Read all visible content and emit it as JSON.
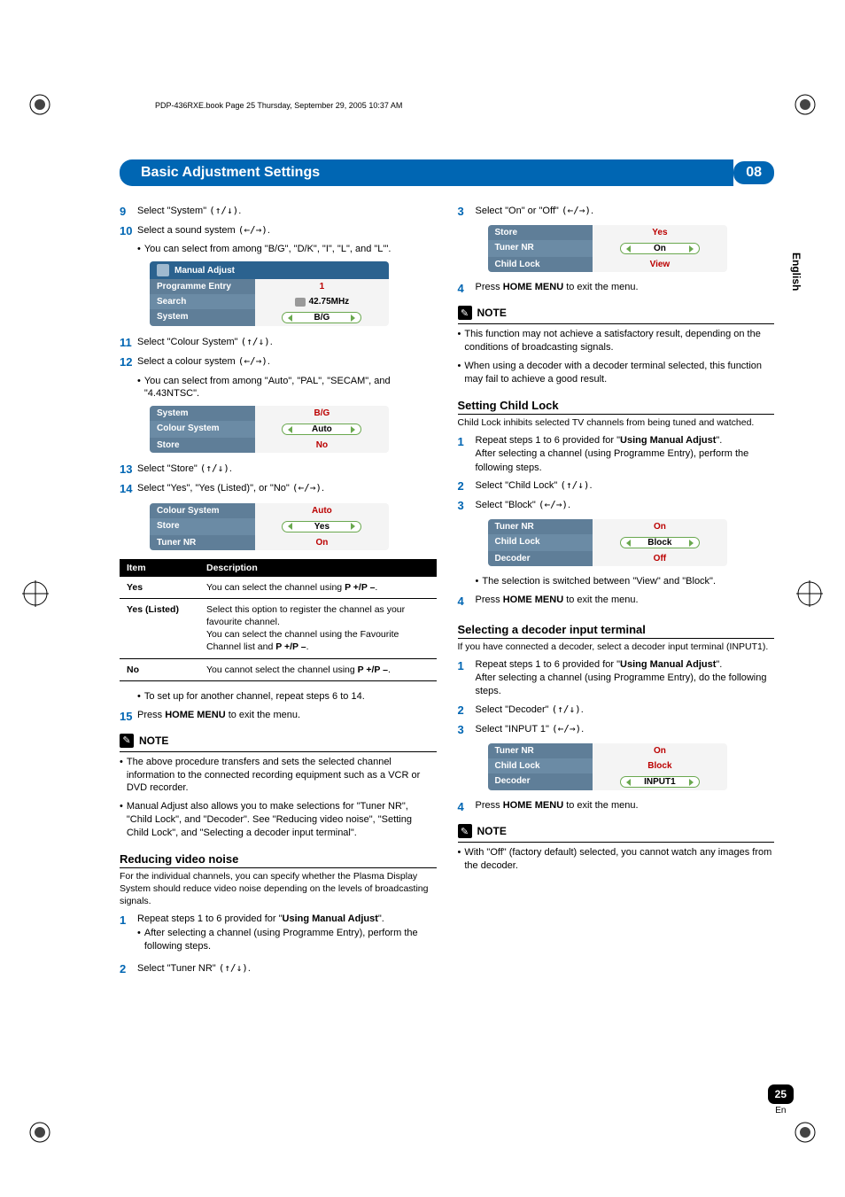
{
  "book_info": "PDP-436RXE.book  Page 25  Thursday, September 29, 2005  10:37 AM",
  "title": "Basic Adjustment Settings",
  "chapter": "08",
  "side_lang": "English",
  "page_lang_abbr": "En",
  "page_number": "25",
  "arrows_ud": "(↑/↓)",
  "arrows_lr": "(←/→)",
  "left": {
    "s9": "Select \"System\" ",
    "s10": "Select a sound system ",
    "s10b": "You can select from among \"B/G\", \"D/K\", \"I\", \"L\", and \"L'\".",
    "menu1": {
      "header": "Manual Adjust",
      "r1l": "Programme Entry",
      "r1v": "1",
      "r2l": "Search",
      "r2v": "42.75MHz",
      "r3l": "System",
      "r3v": "B/G"
    },
    "s11": "Select \"Colour System\" ",
    "s12": "Select a colour system ",
    "s12b": "You can select from among \"Auto\", \"PAL\", \"SECAM\", and \"4.43NTSC\".",
    "menu2": {
      "r1l": "System",
      "r1v": "B/G",
      "r2l": "Colour System",
      "r2v": "Auto",
      "r3l": "Store",
      "r3v": "No"
    },
    "s13": "Select \"Store\" ",
    "s14": "Select \"Yes\", \"Yes (Listed)\", or \"No\" ",
    "menu3": {
      "r1l": "Colour System",
      "r1v": "Auto",
      "r2l": "Store",
      "r2v": "Yes",
      "r3l": "Tuner NR",
      "r3v": "On"
    },
    "table_h1": "Item",
    "table_h2": "Description",
    "r1c1": "Yes",
    "r1c2a": "You can select the channel using ",
    "r1c2b": "P +/P –",
    "r2c1": "Yes (Listed)",
    "r2c2a": "Select this option to register the channel as your favourite channel.",
    "r2c2b": "You can select the channel using the Favourite Channel list and ",
    "r2c2c": "P +/P –",
    "r3c1": "No",
    "r3c2a": "You cannot select the channel using ",
    "r3c2b": "P +/P –",
    "tableb": "To set up for another channel, repeat steps 6 to 14.",
    "s15a": "Press ",
    "s15b": "HOME MENU",
    "s15c": " to exit the menu.",
    "note_label": "NOTE",
    "note1": "The above procedure transfers and sets the selected channel information to the connected recording equipment such as a VCR or DVD recorder.",
    "note2": "Manual Adjust also allows you to make selections for \"Tuner NR\", \"Child Lock\", and \"Decoder\". See \"Reducing video noise\", \"Setting Child Lock\", and \"Selecting a decoder input terminal\".",
    "sec_noise": "Reducing video noise",
    "sec_noise_sub": "For the individual channels, you can specify whether the Plasma Display System should reduce video noise depending on the levels of broadcasting signals.",
    "n1a": "Repeat steps 1 to 6 provided for \"",
    "n1b": "Using Manual Adjust",
    "n1c": "\".",
    "n1d": "After selecting a channel (using Programme Entry), perform the following steps.",
    "n2": "Select \"Tuner NR\" "
  },
  "right": {
    "s3": "Select \"On\" or \"Off\" ",
    "menu4": {
      "r1l": "Store",
      "r1v": "Yes",
      "r2l": "Tuner NR",
      "r2v": "On",
      "r3l": "Child Lock",
      "r3v": "View"
    },
    "s4a": "Press ",
    "s4b": "HOME MENU",
    "s4c": " to exit the menu.",
    "note_label": "NOTE",
    "nn1": "This function may not achieve a satisfactory result, depending on the conditions of broadcasting signals.",
    "nn2": "When using a decoder with a decoder terminal selected, this function may fail to achieve a good result.",
    "sec_lock": "Setting Child Lock",
    "sec_lock_sub": "Child Lock inhibits selected TV channels from being tuned and watched.",
    "l1a": "Repeat steps 1 to 6 provided for \"",
    "l1b": "Using Manual Adjust",
    "l1c": "\".",
    "l1d": "After selecting a channel (using Programme Entry), perform the following steps.",
    "l2": "Select \"Child Lock\" ",
    "l3": "Select \"Block\" ",
    "menu5": {
      "r1l": "Tuner NR",
      "r1v": "On",
      "r2l": "Child Lock",
      "r2v": "Block",
      "r3l": "Decoder",
      "r3v": "Off"
    },
    "lb": "The selection is switched between \"View\" and \"Block\".",
    "l4a": "Press ",
    "l4b": "HOME MENU",
    "l4c": " to exit the menu.",
    "sec_dec": "Selecting a decoder input terminal",
    "sec_dec_sub": "If you have connected a decoder, select a decoder input terminal (INPUT1).",
    "d1a": "Repeat steps 1 to 6 provided for \"",
    "d1b": "Using Manual Adjust",
    "d1c": "\".",
    "d1d": "After selecting a channel (using Programme Entry), do the following steps.",
    "d2": "Select \"Decoder\" ",
    "d3": "Select \"INPUT 1\" ",
    "menu6": {
      "r1l": "Tuner NR",
      "r1v": "On",
      "r2l": "Child Lock",
      "r2v": "Block",
      "r3l": "Decoder",
      "r3v": "INPUT1"
    },
    "d4a": "Press ",
    "d4b": "HOME MENU",
    "d4c": " to exit the menu.",
    "dn1": "With \"Off\" (factory default) selected, you cannot watch any images from the decoder."
  }
}
